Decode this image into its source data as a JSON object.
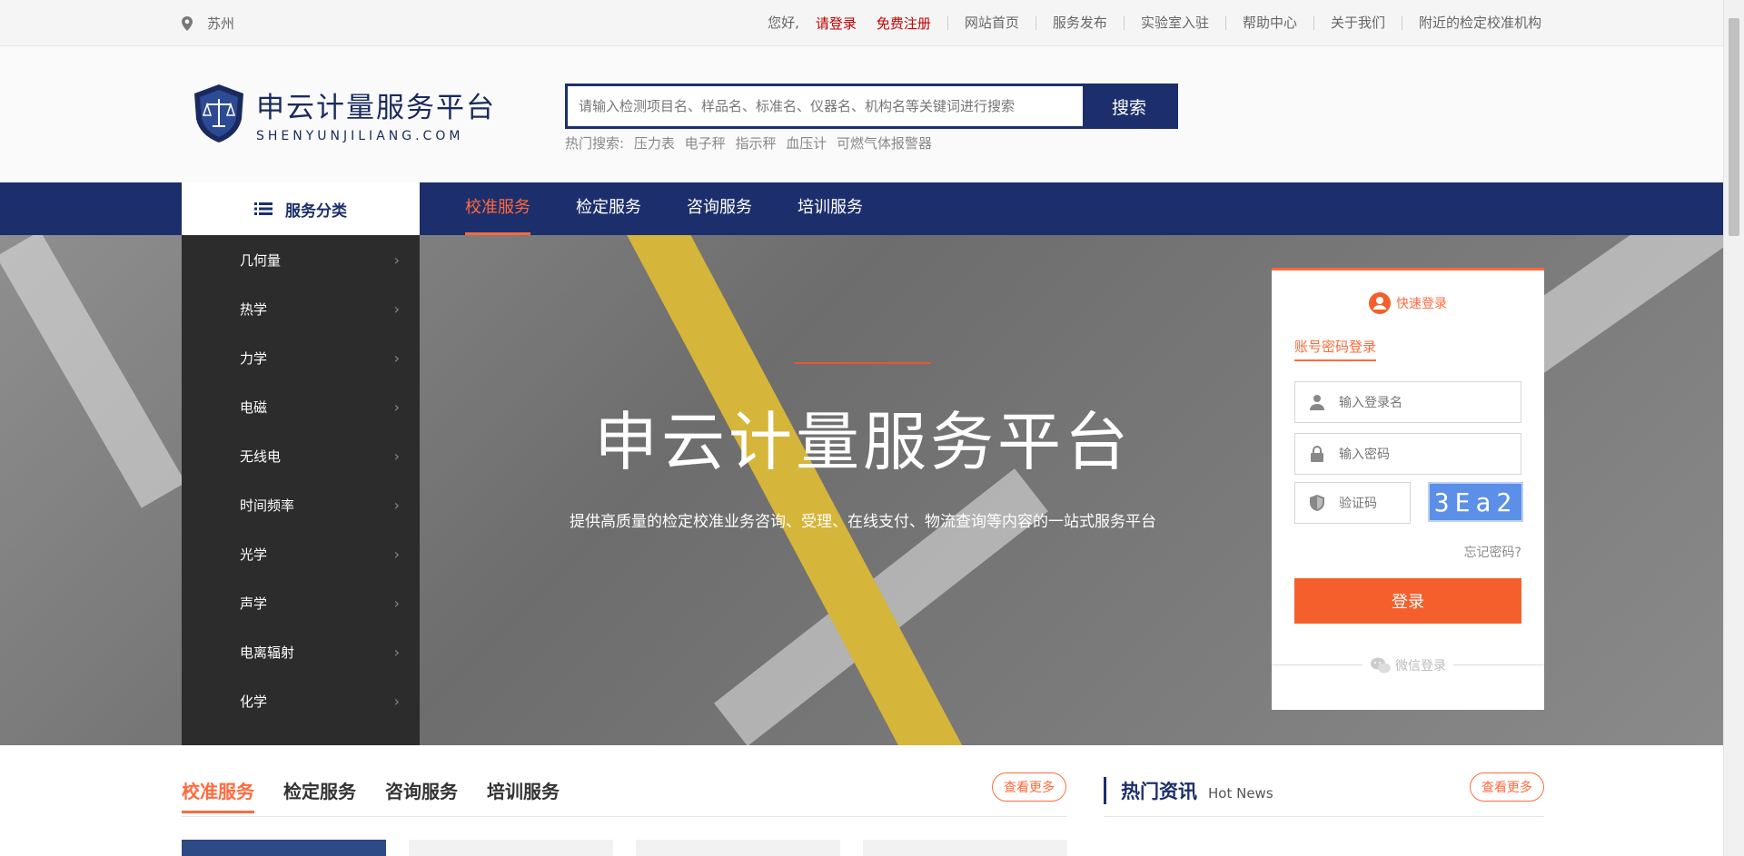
{
  "topbar": {
    "city": "苏州",
    "greeting": "您好,",
    "login_link": "请登录",
    "register_link": "免费注册",
    "links": [
      "网站首页",
      "服务发布",
      "实验室入驻",
      "帮助中心",
      "关于我们",
      "附近的检定校准机构"
    ]
  },
  "header": {
    "logo_title": "申云计量服务平台",
    "logo_sub": "SHENYUNJILIANG.COM",
    "search_placeholder": "请输入检测项目名、样品名、标准名、仪器名、机构名等关键词进行搜索",
    "search_button": "搜索",
    "hot_label": "热门搜索:",
    "hot_terms": [
      "压力表",
      "电子秤",
      "指示秤",
      "血压计",
      "可燃气体报警器"
    ]
  },
  "nav": {
    "category_title": "服务分类",
    "tabs": [
      "校准服务",
      "检定服务",
      "咨询服务",
      "培训服务"
    ]
  },
  "categories": [
    "几何量",
    "热学",
    "力学",
    "电磁",
    "无线电",
    "时间频率",
    "光学",
    "声学",
    "电离辐射",
    "化学"
  ],
  "banner": {
    "title": "申云计量服务平台",
    "subtitle": "提供高质量的检定校准业务咨询、受理、在线支付、物流查询等内容的一站式服务平台"
  },
  "login": {
    "quick_title": "快速登录",
    "tab_label": "账号密码登录",
    "username_placeholder": "输入登录名",
    "password_placeholder": "输入密码",
    "captcha_placeholder": "验证码",
    "captcha_text": "3Ea2",
    "forgot": "忘记密码?",
    "submit": "登录",
    "wechat": "微信登录"
  },
  "services": {
    "tabs": [
      "校准服务",
      "检定服务",
      "咨询服务",
      "培训服务"
    ],
    "more": "查看更多"
  },
  "news": {
    "title": "热门资讯",
    "title_en": "Hot News",
    "more": "查看更多"
  },
  "colors": {
    "brand_blue": "#1c2f6c",
    "accent_orange": "#ff6a3d"
  }
}
